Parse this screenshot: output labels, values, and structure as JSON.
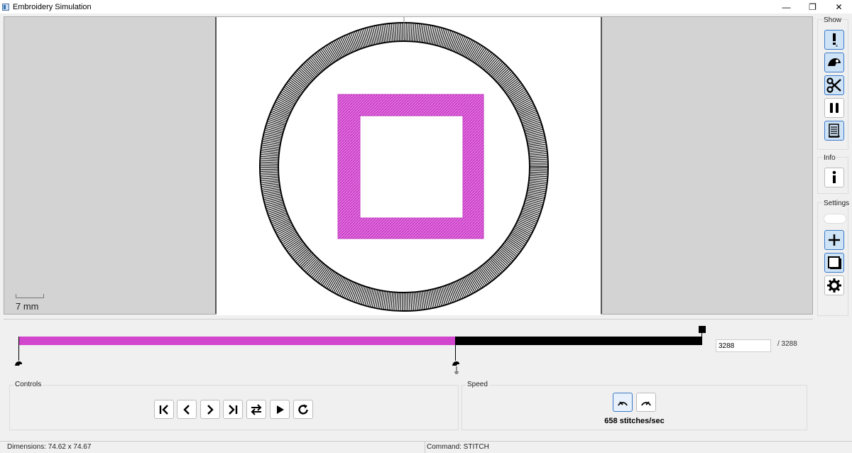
{
  "window": {
    "title": "Embroidery Simulation",
    "controls": {
      "minimize": "—",
      "restore": "❐",
      "close": "✕"
    }
  },
  "canvas": {
    "scale_label": "7 mm",
    "design_color": "#d146cc",
    "hoop_color": "#000000",
    "background": "#d3d3d3",
    "paper": "#ffffff"
  },
  "right_panel": {
    "show_label": "Show",
    "info_label": "Info",
    "settings_label": "Settings",
    "show_buttons": [
      {
        "icon": "jump-warning-icon"
      },
      {
        "icon": "trim-icon"
      },
      {
        "icon": "scissors-icon"
      },
      {
        "icon": "pause-icon"
      },
      {
        "icon": "color-change-icon"
      }
    ],
    "info_button": {
      "icon": "info-icon"
    },
    "settings_buttons": [
      {
        "icon": "toggle-icon"
      },
      {
        "icon": "crosshair-icon"
      },
      {
        "icon": "page-icon"
      },
      {
        "icon": "gear-icon"
      }
    ]
  },
  "progress": {
    "current_stitch": "3288",
    "total_label": "/ 3288",
    "fraction": 0.64,
    "done_color": "#d146cc",
    "rest_color": "#000000"
  },
  "controls": {
    "label": "Controls",
    "buttons": [
      {
        "icon": "first-icon"
      },
      {
        "icon": "prev-icon"
      },
      {
        "icon": "next-icon"
      },
      {
        "icon": "last-icon"
      },
      {
        "icon": "swap-icon"
      },
      {
        "icon": "play-icon"
      },
      {
        "icon": "refresh-icon"
      }
    ]
  },
  "speed": {
    "label": "Speed",
    "value_text": "658 stitches/sec",
    "buttons": [
      {
        "icon": "slower-icon"
      },
      {
        "icon": "faster-icon"
      }
    ]
  },
  "status": {
    "dimensions": "Dimensions: 74.62 x 74.67",
    "command": "Command: STITCH"
  }
}
